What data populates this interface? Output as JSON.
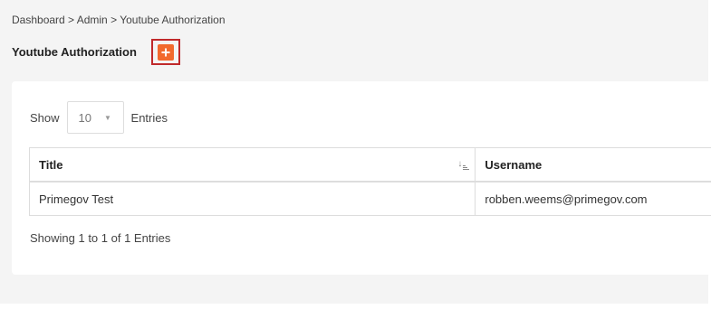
{
  "breadcrumb": {
    "items": [
      "Dashboard",
      "Admin",
      "Youtube Authorization"
    ],
    "separator": " > ",
    "text": "Dashboard > Admin > Youtube Authorization"
  },
  "page": {
    "title": "Youtube Authorization",
    "add_button_icon": "plus-icon",
    "accent_color": "#f26a2e",
    "highlight_color": "#c0292b"
  },
  "entries_control": {
    "show_label": "Show",
    "selected": "10",
    "entries_label": "Entries"
  },
  "table": {
    "columns": [
      {
        "label": "Title",
        "sortable": true,
        "sort_icon": "sort-alpha-asc-icon"
      },
      {
        "label": "Username"
      }
    ],
    "rows": [
      {
        "title": "Primegov Test",
        "username": "robben.weems@primegov.com"
      }
    ]
  },
  "footer": {
    "info": "Showing 1 to 1 of 1 Entries"
  }
}
